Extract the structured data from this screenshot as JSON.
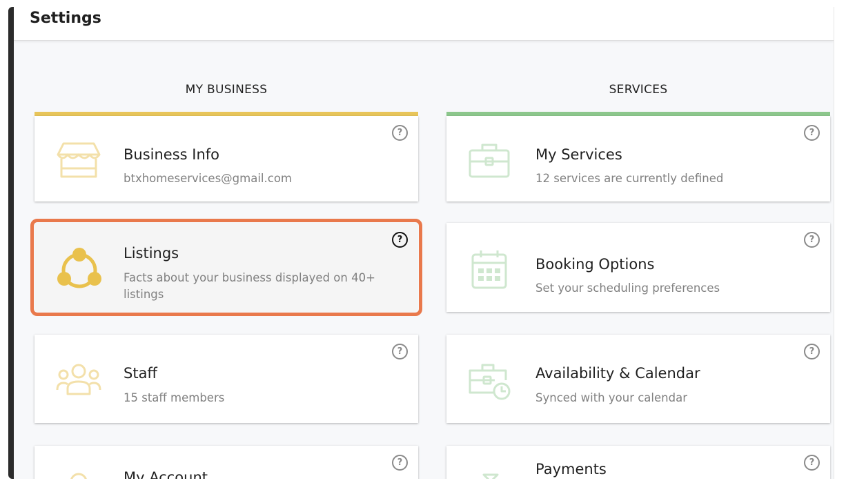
{
  "header": {
    "title": "Settings"
  },
  "columns": {
    "left": {
      "heading": "MY BUSINESS",
      "accent": "#e8c55a"
    },
    "right": {
      "heading": "SERVICES",
      "accent": "#8cc78c"
    }
  },
  "help_glyph": "?",
  "cards": {
    "business_info": {
      "title": "Business Info",
      "subtitle": "btxhomeservices@gmail.com",
      "icon": "storefront-icon"
    },
    "listings": {
      "title": "Listings",
      "subtitle": "Facts about your business displayed on 40+ listings",
      "icon": "network-nodes-icon",
      "selected": true
    },
    "staff": {
      "title": "Staff",
      "subtitle": "15 staff members",
      "icon": "people-group-icon"
    },
    "my_account": {
      "title": "My Account",
      "subtitle": "",
      "icon": "user-icon"
    },
    "my_services": {
      "title": "My Services",
      "subtitle": "12 services are currently defined",
      "icon": "briefcase-icon"
    },
    "booking_options": {
      "title": "Booking Options",
      "subtitle": "Set your scheduling preferences",
      "icon": "calendar-icon"
    },
    "availability": {
      "title": "Availability & Calendar",
      "subtitle": "Synced with your calendar",
      "icon": "briefcase-clock-icon"
    },
    "payments": {
      "title": "Payments",
      "subtitle": "",
      "icon": "payments-icon"
    }
  },
  "colors": {
    "selected_outline": "#e9794c",
    "business_icon": "#f3e0aa",
    "listings_icon": "#e9c14d",
    "services_icon": "#cfe7cf"
  }
}
